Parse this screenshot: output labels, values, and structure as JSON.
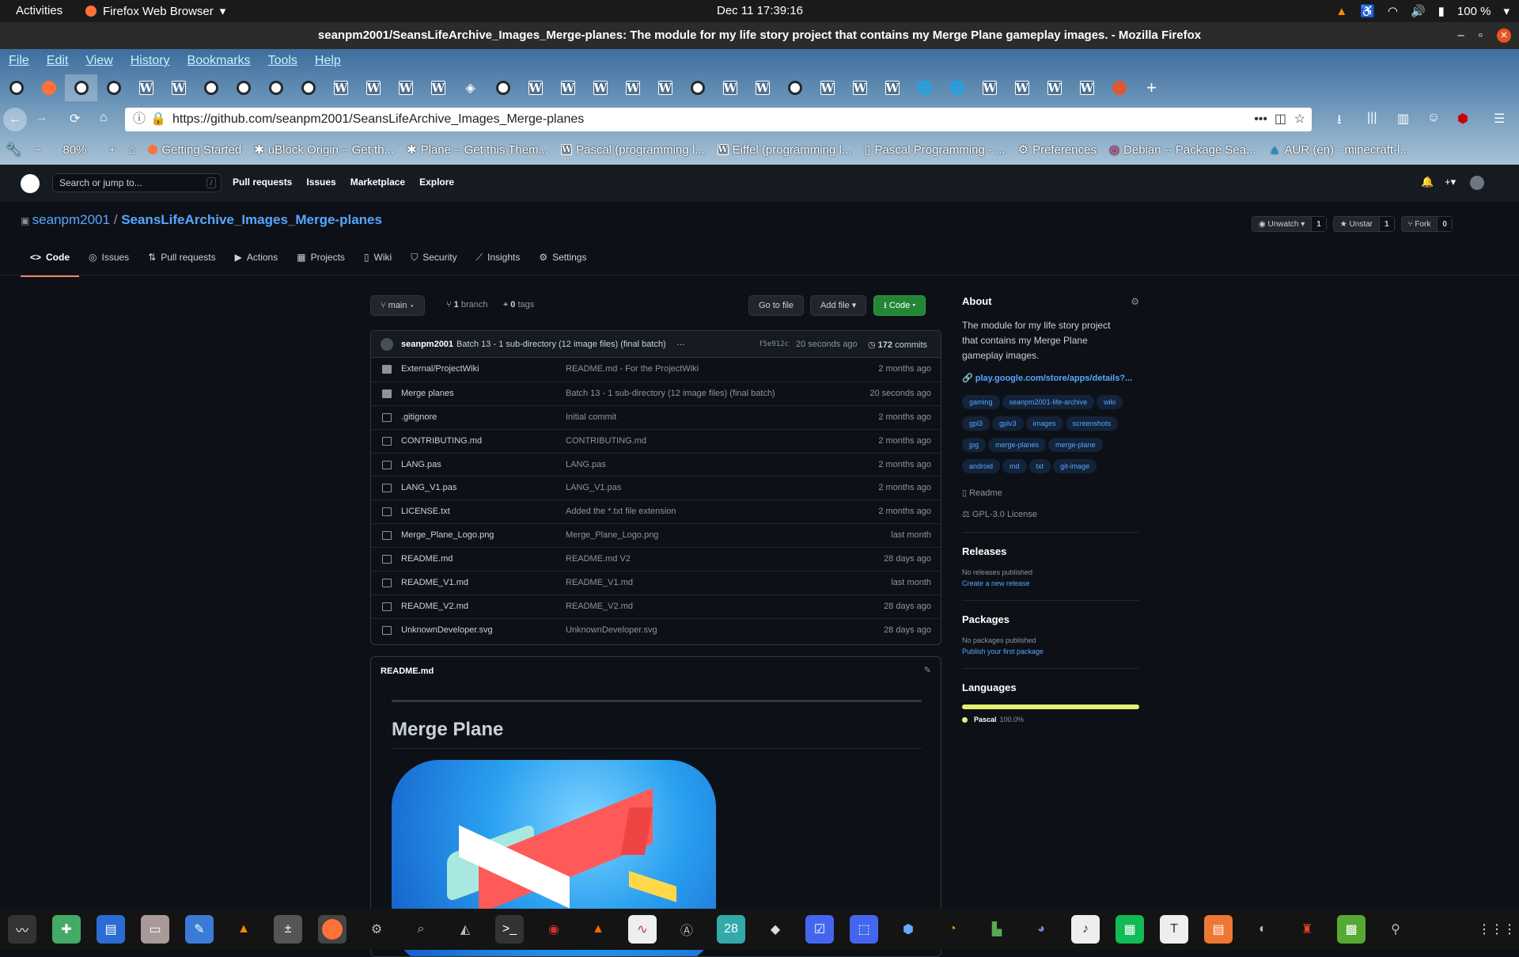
{
  "topbar": {
    "activities": "Activities",
    "app_name": "Firefox Web Browser",
    "clock": "Dec 11  17:39:16",
    "battery": "100 %"
  },
  "window": {
    "title": "seanpm2001/SeansLifeArchive_Images_Merge-planes: The module for my life story project that contains my Merge Plane gameplay images. - Mozilla Firefox"
  },
  "menu": [
    "File",
    "Edit",
    "View",
    "History",
    "Bookmarks",
    "Tools",
    "Help"
  ],
  "url": "https://github.com/seanpm2001/SeansLifeArchive_Images_Merge-planes",
  "zoom": "80%",
  "bookmarks": [
    "Getting Started",
    "uBlock Origin – Get th...",
    "Plane – Get this Them...",
    "Pascal (programming l...",
    "Eiffel (programming l...",
    "Pascal Programming - ...",
    "Preferences",
    "Debian -- Package Sea...",
    "AUR (en) - minecraft-l..."
  ],
  "gh": {
    "search_placeholder": "Search or jump to...",
    "nav": [
      "Pull requests",
      "Issues",
      "Marketplace",
      "Explore"
    ]
  },
  "repo": {
    "owner": "seanpm2001",
    "sep": "/",
    "name": "SeansLifeArchive_Images_Merge-planes",
    "unwatch": "Unwatch",
    "watch_count": "1",
    "unstar": "Unstar",
    "star_count": "1",
    "fork": "Fork",
    "fork_count": "0",
    "tabs": [
      "Code",
      "Issues",
      "Pull requests",
      "Actions",
      "Projects",
      "Wiki",
      "Security",
      "Insights",
      "Settings"
    ]
  },
  "branchbar": {
    "branch": "main",
    "branches": "1",
    "branches_label": "branch",
    "tags": "0",
    "tags_label": "tags",
    "go_to_file": "Go to file",
    "add_file": "Add file",
    "code": "Code"
  },
  "commit": {
    "author": "seanpm2001",
    "message": "Batch 13 - 1 sub-directory (12 image files) (final batch)",
    "hash": "f5e912c",
    "time": "20 seconds ago",
    "count": "172",
    "count_label": "commits"
  },
  "files": [
    {
      "type": "folder",
      "name": "External/ProjectWiki",
      "msg": "README.md - For the ProjectWiki",
      "age": "2 months ago"
    },
    {
      "type": "folder",
      "name": "Merge planes",
      "msg": "Batch 13 - 1 sub-directory (12 image files) (final batch)",
      "age": "20 seconds ago"
    },
    {
      "type": "file",
      "name": ".gitignore",
      "msg": "Initial commit",
      "age": "2 months ago"
    },
    {
      "type": "file",
      "name": "CONTRIBUTING.md",
      "msg": "CONTRIBUTING.md",
      "age": "2 months ago"
    },
    {
      "type": "file",
      "name": "LANG.pas",
      "msg": "LANG.pas",
      "age": "2 months ago"
    },
    {
      "type": "file",
      "name": "LANG_V1.pas",
      "msg": "LANG_V1.pas",
      "age": "2 months ago"
    },
    {
      "type": "file",
      "name": "LICENSE.txt",
      "msg": "Added the *.txt file extension",
      "age": "2 months ago"
    },
    {
      "type": "file",
      "name": "Merge_Plane_Logo.png",
      "msg": "Merge_Plane_Logo.png",
      "age": "last month"
    },
    {
      "type": "file",
      "name": "README.md",
      "msg": "README.md V2",
      "age": "28 days ago"
    },
    {
      "type": "file",
      "name": "README_V1.md",
      "msg": "README_V1.md",
      "age": "last month"
    },
    {
      "type": "file",
      "name": "README_V2.md",
      "msg": "README_V2.md",
      "age": "28 days ago"
    },
    {
      "type": "file",
      "name": "UnknownDeveloper.svg",
      "msg": "UnknownDeveloper.svg",
      "age": "28 days ago"
    }
  ],
  "readme": {
    "filename": "README.md",
    "heading": "Merge Plane"
  },
  "about": {
    "title": "About",
    "description": "The module for my life story project that contains my Merge Plane gameplay images.",
    "link": "play.google.com/store/apps/details?...",
    "topics": [
      "gaming",
      "seanpm2001-life-archive",
      "wiki",
      "gpl3",
      "gplv3",
      "images",
      "screenshots",
      "jpg",
      "merge-planes",
      "merge-plane",
      "android",
      "md",
      "txt",
      "git-image"
    ],
    "readme_label": "Readme",
    "license_label": "GPL-3.0 License"
  },
  "releases": {
    "title": "Releases",
    "none": "No releases published",
    "create": "Create a new release"
  },
  "packages": {
    "title": "Packages",
    "none": "No packages published",
    "publish": "Publish your first package"
  },
  "languages": {
    "title": "Languages",
    "items": [
      {
        "name": "Pascal",
        "percent": "100.0%",
        "color": "#e3f171"
      }
    ]
  },
  "colors": {
    "accent": "#58a6ff",
    "code_button": "#238636",
    "tab_underline": "#f78166"
  }
}
